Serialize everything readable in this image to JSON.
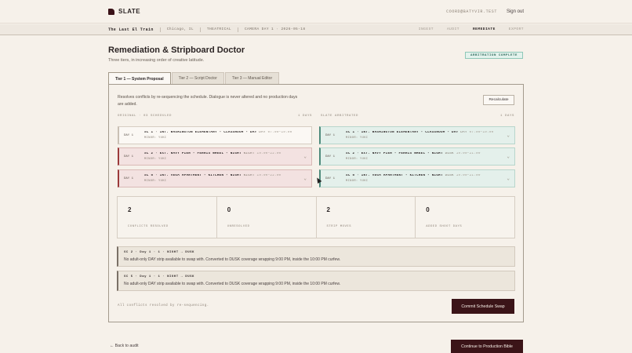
{
  "app": {
    "name": "SLATE"
  },
  "header": {
    "user_email": "COORD@BATYVIR.TEST",
    "sign_out": "Sign out"
  },
  "project": {
    "title": "The Last El Train",
    "location": "Chicago, IL",
    "type": "THEATRICAL",
    "camera_day": "CAMERA DAY 1 · 2026-05-18"
  },
  "steps": [
    "INGEST",
    "AUDIT",
    "REMEDIATE",
    "EXPORT"
  ],
  "page": {
    "title": "Remediation & Stripboard Doctor",
    "subtitle": "Three tiers, in increasing order of creative latitude.",
    "badge": "ARBITRATION COMPLETE"
  },
  "tabs": [
    "Tier 1 — System Proposal",
    "Tier 2 — Script Doctor",
    "Tier 3 — Manual Editor"
  ],
  "tier1": {
    "description": "Resolves conflicts by re-sequencing the schedule. Dialogue is never altered and no production days are added.",
    "recalculate": "Recalculate",
    "original_header": "ORIGINAL · 03 SCHEDULED",
    "original_days": "1 DAYS",
    "arbitrated_header": "SLATE ARBITRATED",
    "arbitrated_days": "1 DAYS",
    "original_rows": [
      {
        "day": "DAY 1",
        "title": "SC 1 · INT. WASHINGTON ELEMENTARY - CLASSROOM - DAY",
        "tag": "DAY",
        "time": "07:00–19:00",
        "sub": "MINOR: YUKI",
        "state": "ok"
      },
      {
        "day": "DAY 1",
        "title": "SC 2 · EXT. NAVY PIER - FERRIS WHEEL - NIGHT",
        "tag": "NIGHT",
        "time": "19:00–22:00",
        "sub": "MINOR: YUKI",
        "state": "conflict"
      },
      {
        "day": "DAY 1",
        "title": "SC 5 · INT. VEGA APARTMENT - KITCHEN - NIGHT",
        "tag": "NIGHT",
        "time": "19:00–22:00",
        "sub": "MINOR: YUKI",
        "state": "conflict"
      }
    ],
    "arbitrated_rows": [
      {
        "day": "DAY 1",
        "title": "SC 1 · INT. WASHINGTON ELEMENTARY - CLASSROOM - DAY",
        "tag": "DAY",
        "time": "07:00–19:00",
        "sub": "MINOR: YUKI"
      },
      {
        "day": "DAY 1",
        "title": "SC 2 · EXT. NAVY PIER - FERRIS WHEEL - NIGHT",
        "tag": "DUSK",
        "time": "19:00–21:00",
        "sub": "MINOR: YUKI"
      },
      {
        "day": "DAY 1",
        "title": "SC 5 · INT. VEGA APARTMENT - KITCHEN - NIGHT",
        "tag": "DUSK",
        "time": "19:00–21:00",
        "sub": "MINOR: YUKI"
      }
    ],
    "stats": [
      {
        "value": "2",
        "label": "CONFLICTS RESOLVED"
      },
      {
        "value": "0",
        "label": "UNRESOLVED"
      },
      {
        "value": "2",
        "label": "STRIP MOVES"
      },
      {
        "value": "0",
        "label": "ADDED SHOOT DAYS"
      }
    ],
    "notes": [
      {
        "title": "SC 2 · Day 1 · 1 · NIGHT → DUSK",
        "body": "No adult-only DAY strip available to swap with. Converted to DUSK coverage wrapping 9:00 PM, inside the 10:00 PM curfew."
      },
      {
        "title": "SC 5 · Day 1 · 1 · NIGHT → DUSK",
        "body": "No adult-only DAY strip available to swap with. Converted to DUSK coverage wrapping 9:00 PM, inside the 10:00 PM curfew."
      }
    ],
    "footnote": "All conflicts resolved by re-sequencing.",
    "commit": "Commit Schedule Swap"
  },
  "footer": {
    "back": "← Back to audit",
    "continue": "Continue to Production Bible"
  }
}
